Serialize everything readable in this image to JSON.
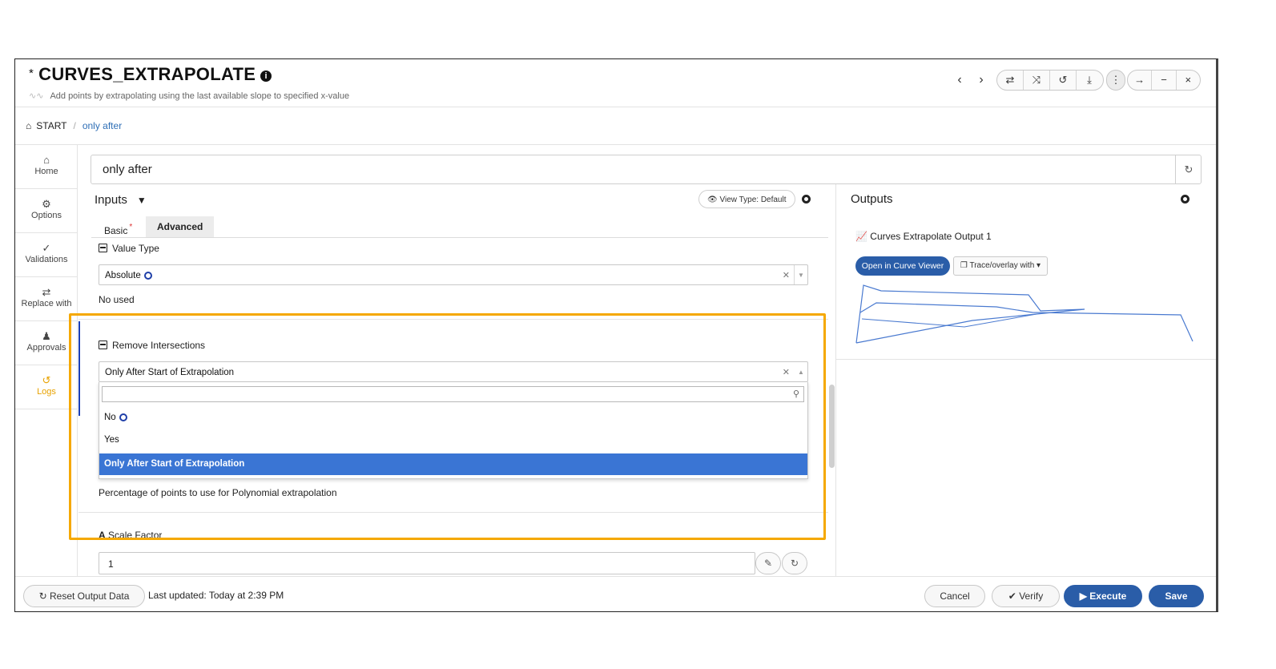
{
  "header": {
    "modified_marker": "*",
    "title": "CURVES_EXTRAPOLATE",
    "subtitle": "Add points by extrapolating using the last available slope to specified x-value",
    "toolbar": {
      "prev": "‹",
      "next": "›",
      "swap": "⇄",
      "shuffle": "⤨",
      "undo": "↺",
      "download": "⤓",
      "more": "⋮",
      "forward": "→",
      "minimize": "−",
      "close": "×"
    }
  },
  "breadcrumb": {
    "root": "START",
    "separator": "/",
    "current": "only after"
  },
  "sidebar": {
    "items": [
      {
        "label": "Home",
        "icon": "home-icon"
      },
      {
        "label": "Options",
        "icon": "gear-icon"
      },
      {
        "label": "Validations",
        "icon": "check-icon"
      },
      {
        "label": "Replace with",
        "icon": "swap-icon"
      },
      {
        "label": "Approvals",
        "icon": "user-check-icon"
      },
      {
        "label": "Logs",
        "icon": "history-icon"
      }
    ]
  },
  "name_field": {
    "value": "only after"
  },
  "inputs": {
    "title": "Inputs",
    "view_type": "View Type: Default",
    "tabs": [
      {
        "label": "Basic",
        "required": "*"
      },
      {
        "label": "Advanced"
      }
    ],
    "value_type": {
      "label": "Value Type",
      "selected": "Absolute",
      "help": "No used"
    },
    "remove_intersections": {
      "label": "Remove Intersections",
      "selected": "Only After Start of Extrapolation",
      "options": [
        "No",
        "Yes",
        "Only After Start of Extrapolation"
      ]
    },
    "percentage_help": "Percentage of points to use for Polynomial extrapolation",
    "scale_factor": {
      "label": "Scale Factor",
      "value": "1"
    }
  },
  "outputs": {
    "title": "Outputs",
    "item": "Curves Extrapolate Output 1",
    "open_viewer": "Open in Curve Viewer",
    "trace": "Trace/overlay with"
  },
  "footer": {
    "reset": "Reset Output Data",
    "last_updated": "Last updated: Today at 2:39 PM",
    "cancel": "Cancel",
    "verify": "Verify",
    "execute": "Execute",
    "save": "Save"
  },
  "colors": {
    "primary": "#2a5da8",
    "highlight": "#f5a800",
    "accent_bar": "#1a3fb8",
    "selected_option": "#3a75d4",
    "logs_active": "#e8a200"
  }
}
